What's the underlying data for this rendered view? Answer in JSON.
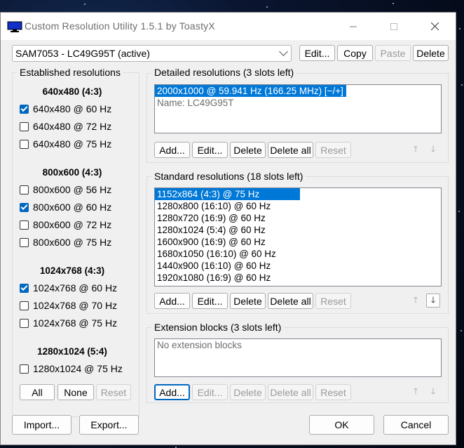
{
  "window": {
    "title": "Custom Resolution Utility 1.5.1 by ToastyX"
  },
  "monitor": {
    "selected": "SAM7053 - LC49G95T (active)",
    "edit": "Edit...",
    "copy": "Copy",
    "paste": "Paste",
    "delete": "Delete"
  },
  "established": {
    "label": "Established resolutions",
    "groups": [
      {
        "heading": "640x480 (4:3)",
        "items": [
          {
            "label": "640x480 @ 60 Hz",
            "checked": true
          },
          {
            "label": "640x480 @ 72 Hz",
            "checked": false
          },
          {
            "label": "640x480 @ 75 Hz",
            "checked": false
          }
        ]
      },
      {
        "heading": "800x600 (4:3)",
        "items": [
          {
            "label": "800x600 @ 56 Hz",
            "checked": false
          },
          {
            "label": "800x600 @ 60 Hz",
            "checked": true
          },
          {
            "label": "800x600 @ 72 Hz",
            "checked": false
          },
          {
            "label": "800x600 @ 75 Hz",
            "checked": false
          }
        ]
      },
      {
        "heading": "1024x768 (4:3)",
        "items": [
          {
            "label": "1024x768 @ 60 Hz",
            "checked": true
          },
          {
            "label": "1024x768 @ 70 Hz",
            "checked": false
          },
          {
            "label": "1024x768 @ 75 Hz",
            "checked": false
          }
        ]
      },
      {
        "heading": "1280x1024 (5:4)",
        "items": [
          {
            "label": "1280x1024 @ 75 Hz",
            "checked": false
          }
        ]
      }
    ],
    "all": "All",
    "none": "None",
    "reset": "Reset"
  },
  "detailed": {
    "label": "Detailed resolutions (3 slots left)",
    "items": [
      "2000x1000 @ 59.941 Hz (166.25 MHz) [−/+]",
      "Name: LC49G95T"
    ],
    "add": "Add...",
    "edit": "Edit...",
    "delete": "Delete",
    "delete_all": "Delete all",
    "reset": "Reset"
  },
  "standard": {
    "label": "Standard resolutions (18 slots left)",
    "items": [
      "1152x864 (4:3) @ 75 Hz",
      "1280x800 (16:10) @ 60 Hz",
      "1280x720 (16:9) @ 60 Hz",
      "1280x1024 (5:4) @ 60 Hz",
      "1600x900 (16:9) @ 60 Hz",
      "1680x1050 (16:10) @ 60 Hz",
      "1440x900 (16:10) @ 60 Hz",
      "1920x1080 (16:9) @ 60 Hz"
    ],
    "add": "Add...",
    "edit": "Edit...",
    "delete": "Delete",
    "delete_all": "Delete all",
    "reset": "Reset"
  },
  "extension": {
    "label": "Extension blocks (3 slots left)",
    "empty": "No extension blocks",
    "add": "Add...",
    "edit": "Edit...",
    "delete": "Delete",
    "delete_all": "Delete all",
    "reset": "Reset"
  },
  "footer": {
    "import": "Import...",
    "export": "Export...",
    "ok": "OK",
    "cancel": "Cancel"
  },
  "icons": {
    "up": "arrow-up-icon",
    "down": "arrow-down-icon",
    "app": "monitor-icon"
  },
  "colors": {
    "selection": "#0078d7",
    "checkbox": "#0067c0"
  }
}
